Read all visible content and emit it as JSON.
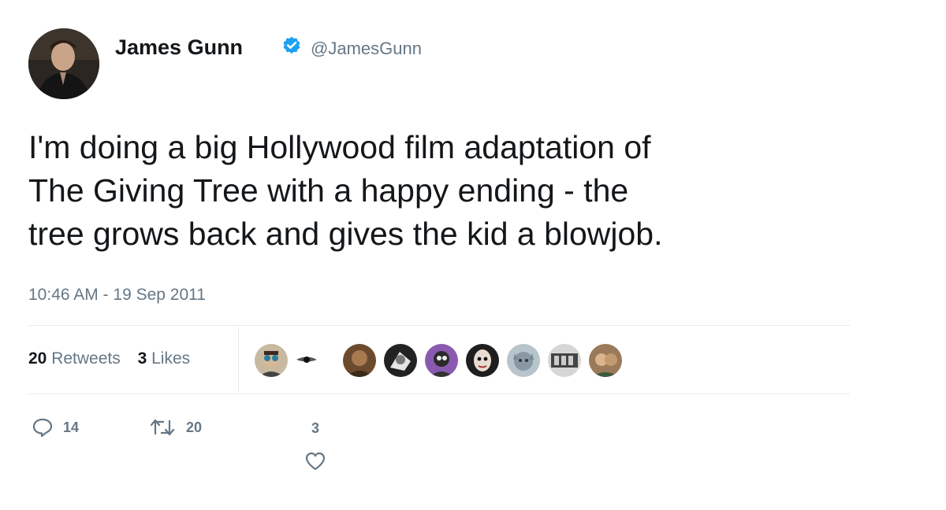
{
  "user": {
    "display_name": "James Gunn",
    "handle": "@JamesGunn",
    "verified": true,
    "avatar_icon": "profile-photo"
  },
  "tweet": {
    "text_lines": [
      "I'm doing a big Hollywood film adaptation of",
      "The Giving Tree with a happy ending - the",
      "tree grows back and gives the kid a blowjob."
    ],
    "timestamp": "10:46 AM - 19 Sep 2011"
  },
  "stats": {
    "retweets_count": "20",
    "retweets_label": "Retweets",
    "likes_count": "3",
    "likes_label": "Likes"
  },
  "likers": [
    {
      "icon": "liker-avatar-1",
      "color": "#3a4a5a"
    },
    {
      "icon": "liker-avatar-2",
      "color": "#4a4a4a"
    },
    {
      "icon": "liker-avatar-3",
      "color": "#5a4030"
    },
    {
      "icon": "liker-avatar-4",
      "color": "#222222"
    },
    {
      "icon": "liker-avatar-5",
      "color": "#6a3a8a"
    },
    {
      "icon": "liker-avatar-6",
      "color": "#2a2a2a"
    },
    {
      "icon": "liker-avatar-7",
      "color": "#7a8a9a"
    },
    {
      "icon": "liker-avatar-8",
      "color": "#8a8a8a"
    },
    {
      "icon": "liker-avatar-9",
      "color": "#6a5a4a"
    }
  ],
  "actions": {
    "reply_count": "14",
    "retweet_count": "20",
    "like_count": "3"
  },
  "colors": {
    "verified_badge": "#1da1f2",
    "secondary_text": "#657786",
    "primary_text": "#14171a"
  }
}
